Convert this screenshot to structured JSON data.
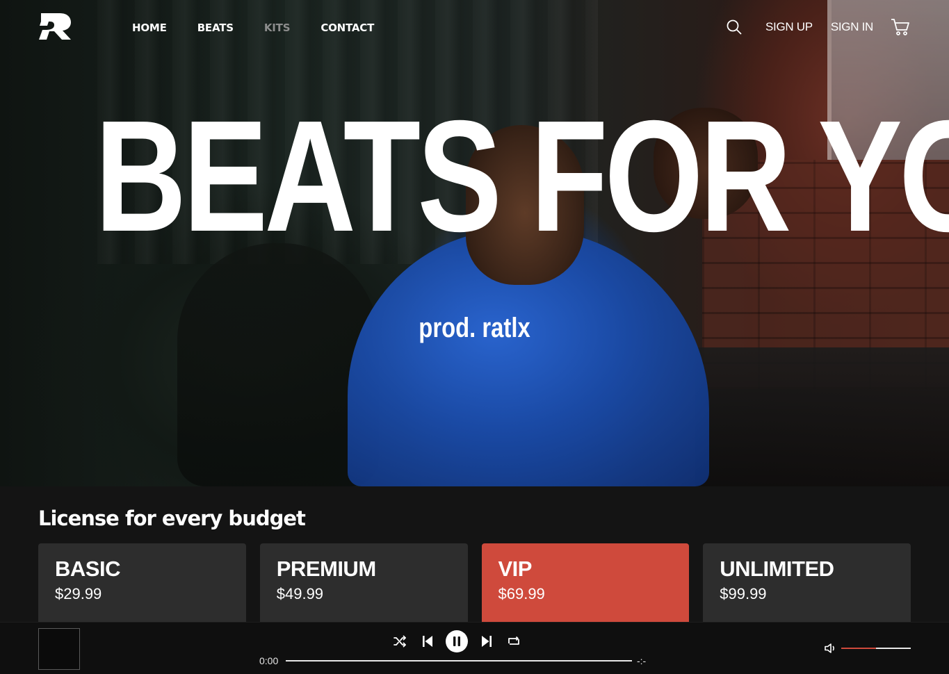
{
  "brand": {
    "logo_icon": "r-logo-icon"
  },
  "nav": {
    "links": [
      {
        "label": "HOME",
        "active": false
      },
      {
        "label": "BEATS",
        "active": false
      },
      {
        "label": "KITS",
        "active": true
      },
      {
        "label": "CONTACT",
        "active": false
      }
    ],
    "search_icon": "search-icon",
    "sign_up": "SIGN UP",
    "sign_in": "SIGN IN",
    "cart_icon": "cart-icon"
  },
  "hero": {
    "title": "BEATS FOR YOU",
    "subtitle": "prod. ratlx"
  },
  "licenses": {
    "title": "License for every budget",
    "selected": "VIP",
    "accent_color": "#cf4a3c",
    "cards": [
      {
        "name": "BASIC",
        "price": "$29.99"
      },
      {
        "name": "PREMIUM",
        "price": "$49.99"
      },
      {
        "name": "VIP",
        "price": "$69.99"
      },
      {
        "name": "UNLIMITED",
        "price": "$99.99"
      }
    ]
  },
  "player": {
    "current_time": "0:00",
    "duration": "-:-",
    "progress": 0,
    "volume": 0.5,
    "icons": [
      "shuffle-icon",
      "previous-icon",
      "pause-icon",
      "next-icon",
      "repeat-icon",
      "volume-icon"
    ]
  }
}
